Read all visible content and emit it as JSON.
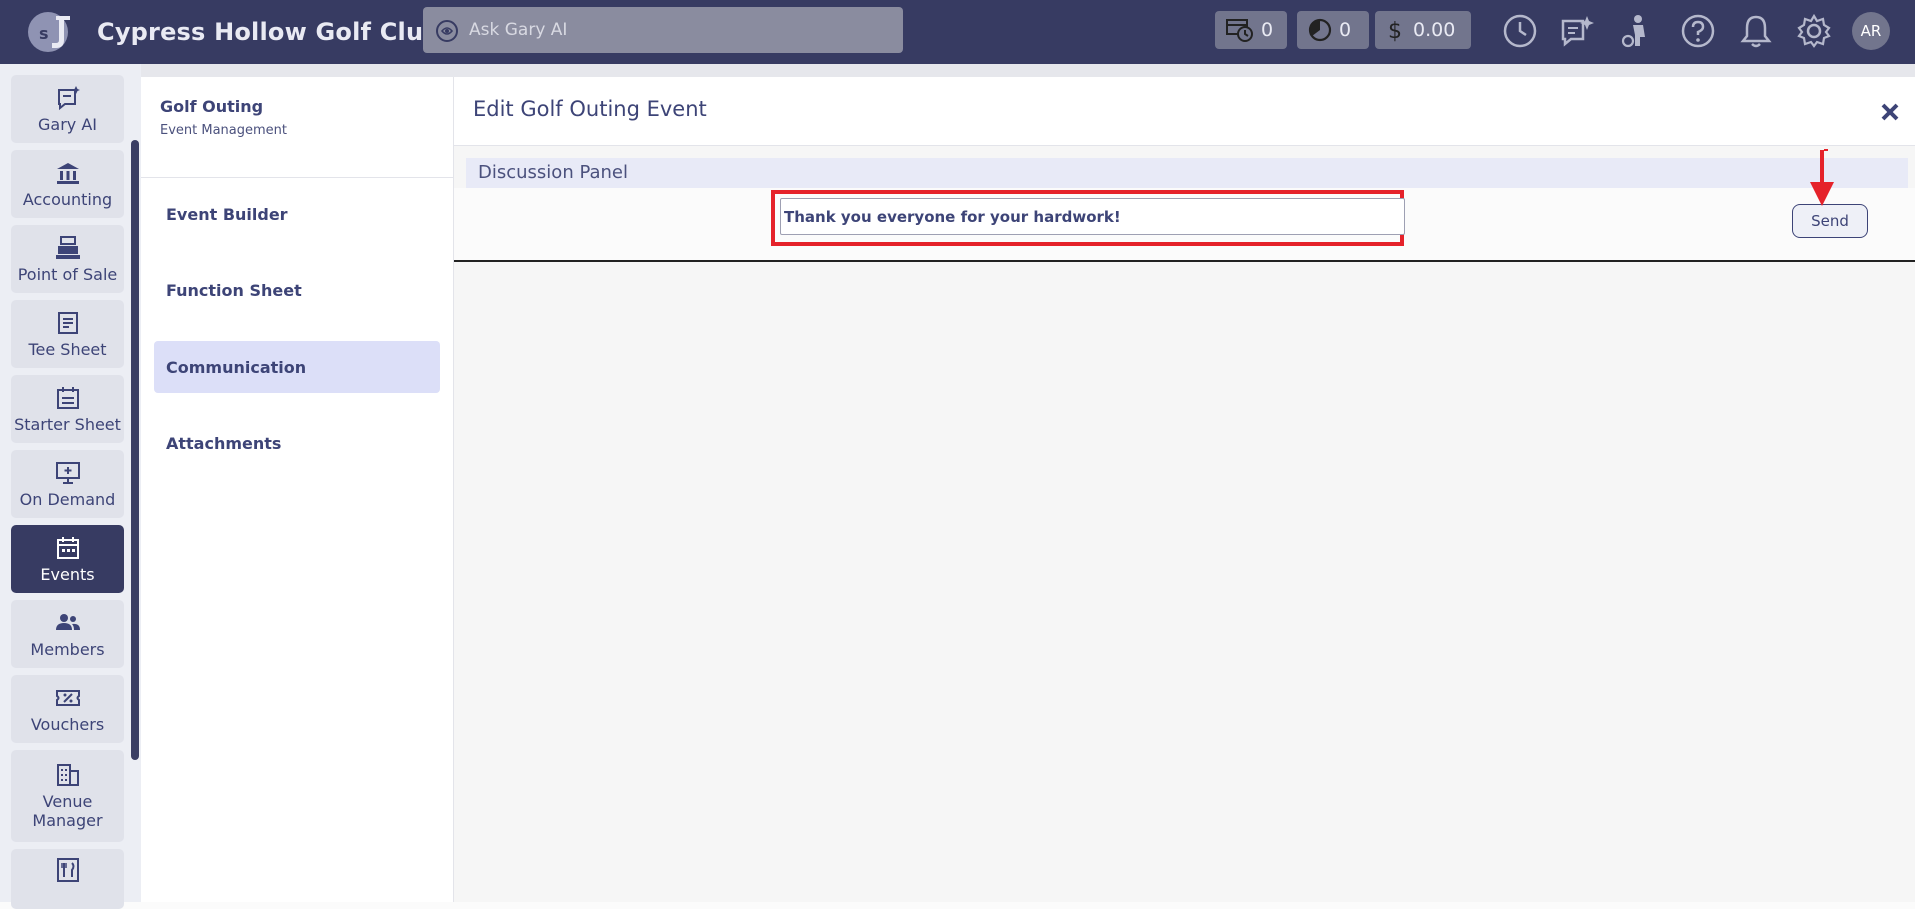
{
  "app": {
    "club_name": "Cypress Hollow Golf Club",
    "search_placeholder": "Ask Gary AI",
    "stats": [
      {
        "icon": "tee-time-icon",
        "value": "0"
      },
      {
        "icon": "pie-chart-icon",
        "value": "0"
      },
      {
        "icon": "dollar-icon",
        "value": "0.00"
      }
    ],
    "top_icons": [
      "clock-icon",
      "chat-star-icon",
      "golfer-icon",
      "help-icon",
      "bell-icon",
      "gear-icon"
    ],
    "avatar_initials": "AR"
  },
  "sidebar": {
    "items": [
      {
        "label": "Gary AI",
        "icon": "chat-icon"
      },
      {
        "label": "Accounting",
        "icon": "bank-icon"
      },
      {
        "label": "Point of Sale",
        "icon": "register-icon"
      },
      {
        "label": "Tee Sheet",
        "icon": "document-icon"
      },
      {
        "label": "Starter Sheet",
        "icon": "calendar-list-icon"
      },
      {
        "label": "On Demand",
        "icon": "monitor-plus-icon"
      },
      {
        "label": "Events",
        "icon": "calendar-icon",
        "active": true
      },
      {
        "label": "Members",
        "icon": "people-icon"
      },
      {
        "label": "Vouchers",
        "icon": "voucher-icon"
      },
      {
        "label": "Venue Manager",
        "icon": "building-icon"
      },
      {
        "label": "",
        "icon": "utensils-icon"
      }
    ]
  },
  "subnav": {
    "title": "Golf Outing",
    "subtitle": "Event Management",
    "items": [
      {
        "label": "Event Builder"
      },
      {
        "label": "Function Sheet"
      },
      {
        "label": "Communication",
        "active": true
      },
      {
        "label": "Attachments"
      }
    ]
  },
  "main": {
    "title": "Edit Golf Outing Event",
    "panel_title": "Discussion Panel",
    "message_value": "Thank you everyone for your hardwork!",
    "send_label": "Send"
  },
  "colors": {
    "topbar": "#373b62",
    "accent": "#3d4477",
    "highlight": "#e5222a",
    "active_subnav": "#dcdff8"
  }
}
